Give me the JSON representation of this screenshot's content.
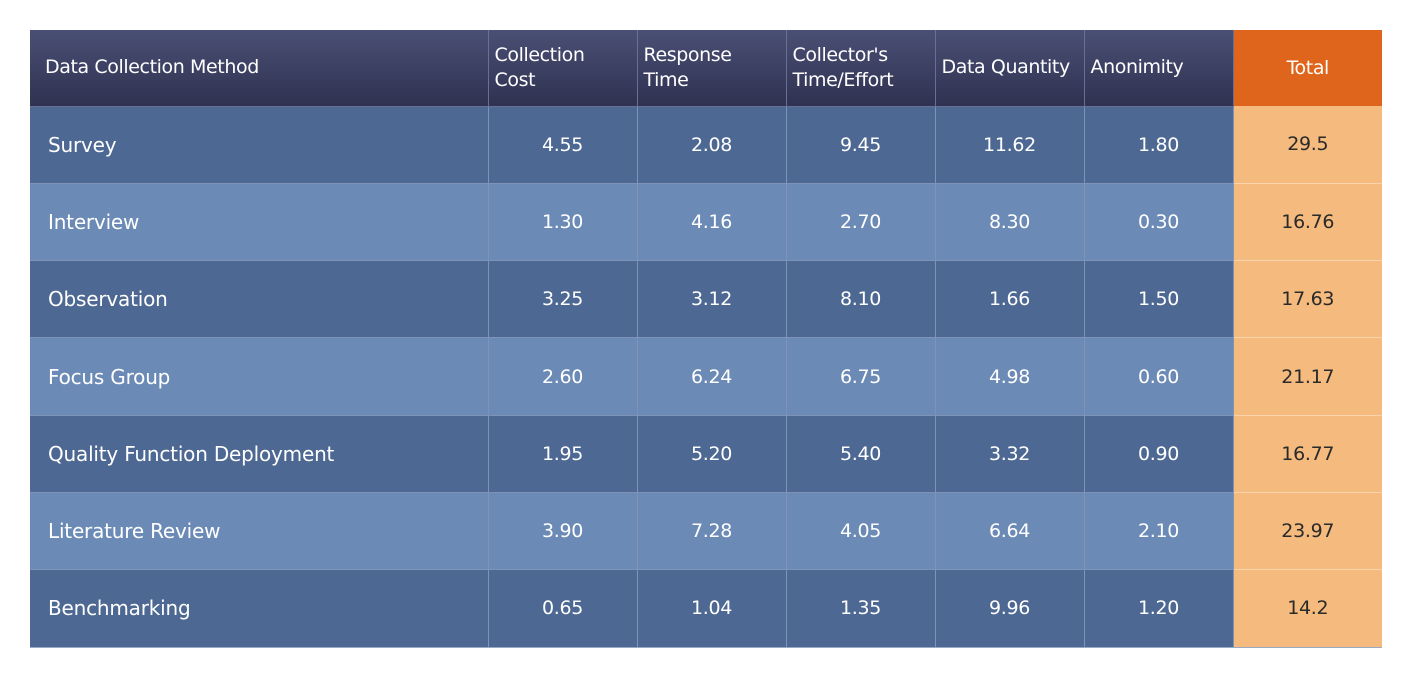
{
  "table": {
    "headers": [
      "Data Collection Method",
      "Collection Cost",
      "Response Time",
      "Collector's Time/Effort",
      "Data Quantity",
      "Anonimity",
      "Total"
    ],
    "header_lines": [
      [
        "Data Collection Method"
      ],
      [
        "Collection",
        "Cost"
      ],
      [
        "Response",
        "Time"
      ],
      [
        "Collector's",
        "Time/Effort"
      ],
      [
        "Data Quantity"
      ],
      [
        "Anonimity"
      ],
      [
        "Total"
      ]
    ],
    "rows": [
      {
        "method": "Survey",
        "values": [
          "4.55",
          "2.08",
          "9.45",
          "11.62",
          "1.80"
        ],
        "total": "29.5"
      },
      {
        "method": "Interview",
        "values": [
          "1.30",
          "4.16",
          "2.70",
          "8.30",
          "0.30"
        ],
        "total": "16.76"
      },
      {
        "method": "Observation",
        "values": [
          "3.25",
          "3.12",
          "8.10",
          "1.66",
          "1.50"
        ],
        "total": "17.63"
      },
      {
        "method": "Focus Group",
        "values": [
          "2.60",
          "6.24",
          "6.75",
          "4.98",
          "0.60"
        ],
        "total": "21.17"
      },
      {
        "method": "Quality Function Deployment",
        "values": [
          "1.95",
          "5.20",
          "5.40",
          "3.32",
          "0.90"
        ],
        "total": "16.77"
      },
      {
        "method": "Literature Review",
        "values": [
          "3.90",
          "7.28",
          "4.05",
          "6.64",
          "2.10"
        ],
        "total": "23.97"
      },
      {
        "method": "Benchmarking",
        "values": [
          "0.65",
          "1.04",
          "1.35",
          "9.96",
          "1.20"
        ],
        "total": "14.2"
      }
    ]
  },
  "colors": {
    "header_bg": "#3d4163",
    "total_header_bg": "#e0651c",
    "row_dark": "#4d6892",
    "row_light": "#6b8ab5",
    "total_cell_bg": "#f4ba7e"
  }
}
